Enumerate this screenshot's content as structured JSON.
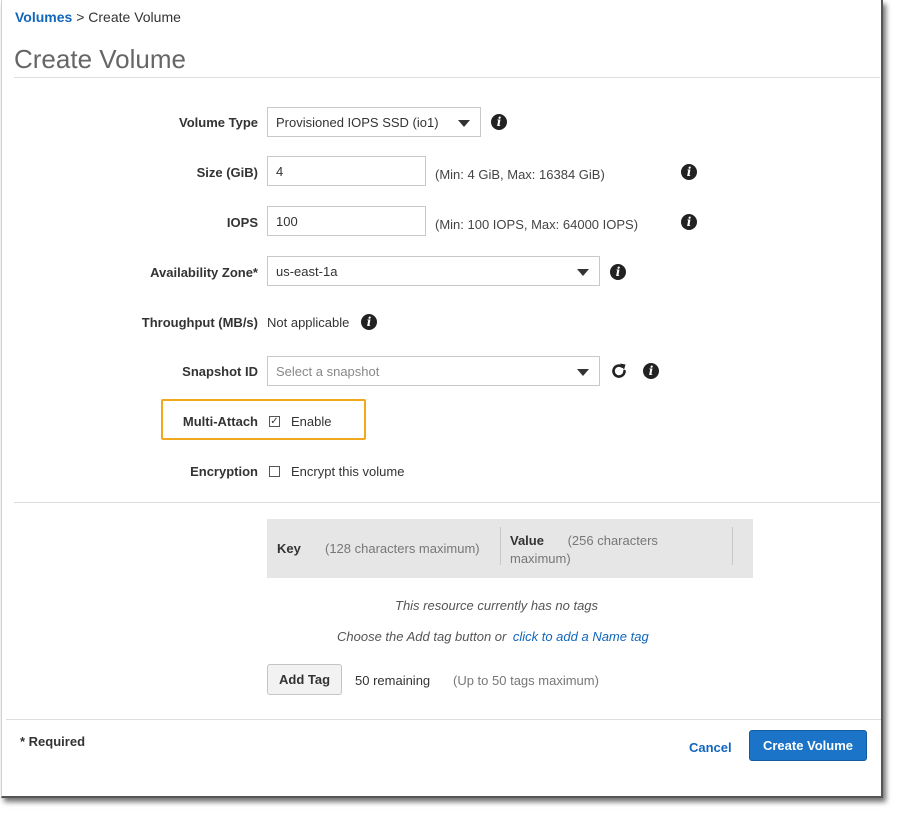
{
  "breadcrumb": {
    "link": "Volumes",
    "separator": " > ",
    "current": "Create Volume"
  },
  "page_title": "Create Volume",
  "form": {
    "volume_type": {
      "label": "Volume Type",
      "value": "Provisioned IOPS SSD (io1)"
    },
    "size": {
      "label": "Size (GiB)",
      "value": "4",
      "hint": "(Min: 4 GiB, Max: 16384 GiB)"
    },
    "iops": {
      "label": "IOPS",
      "value": "100",
      "hint": "(Min: 100 IOPS, Max: 64000 IOPS)"
    },
    "availability_zone": {
      "label": "Availability Zone*",
      "value": "us-east-1a"
    },
    "throughput": {
      "label": "Throughput (MB/s)",
      "value": "Not applicable"
    },
    "snapshot_id": {
      "label": "Snapshot ID",
      "placeholder": "Select a snapshot"
    },
    "multi_attach": {
      "label": "Multi-Attach",
      "option": "Enable",
      "checked": true
    },
    "encryption": {
      "label": "Encryption",
      "option": "Encrypt this volume",
      "checked": false
    }
  },
  "tags": {
    "key_header": "Key",
    "key_hint": "(128 characters maximum)",
    "value_header": "Value",
    "value_hint_line1": "(256 characters",
    "value_hint_line2": "maximum)",
    "empty_message": "This resource currently has no tags",
    "prompt_text": "Choose the Add tag button or",
    "prompt_link": "click to add a Name tag",
    "add_tag_label": "Add Tag",
    "remaining": "50 remaining",
    "limit": "(Up to 50 tags maximum)"
  },
  "footer": {
    "required_note": "* Required",
    "cancel_label": "Cancel",
    "create_label": "Create Volume"
  },
  "colors": {
    "accent": "#1b74c7",
    "link": "#1166bb",
    "highlight": "#f0a81c"
  }
}
